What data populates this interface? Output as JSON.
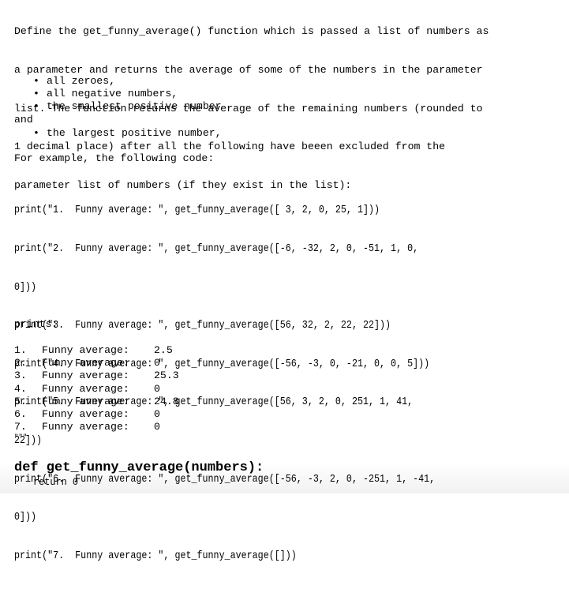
{
  "description": {
    "lines": [
      "Define the get_funny_average() function which is passed a list of numbers as",
      "a parameter and returns the average of some of the numbers in the parameter",
      "list. The function returns the average of the remaining numbers (rounded to",
      "1 decimal place) after all the following have beeen excluded from the",
      "parameter list of numbers (if they exist in the list):"
    ],
    "bullets": [
      "all zeroes,",
      "all negative numbers,",
      "the smallest positive number"
    ],
    "and_word": "and",
    "bullets_after": [
      "the largest positive number,"
    ],
    "bullet_glyph": "•",
    "example_intro": "For example, the following code:"
  },
  "code_example": {
    "lines": [
      "print(\"1.  Funny average: \", get_funny_average([ 3, 2, 0, 25, 1]))",
      "print(\"2.  Funny average: \", get_funny_average([-6, -32, 2, 0, -51, 1, 0,",
      "0]))",
      "print(\"3.  Funny average: \", get_funny_average([56, 32, 2, 22, 22]))",
      "print(\"4.  Funny average: \", get_funny_average([-56, -3, 0, -21, 0, 0, 5]))",
      "print(\"5.  Funny average: \", get_funny_average([56, 3, 2, 0, 251, 1, 41,",
      "22]))",
      "print(\"6.  Funny average: \", get_funny_average([-56, -3, 2, 0, -251, 1, -41,",
      "0]))",
      "print(\"7.  Funny average: \", get_funny_average([]))"
    ]
  },
  "output": {
    "label": "prints:",
    "rows": [
      {
        "num": "1.",
        "label": "Funny average:",
        "value": "2.5"
      },
      {
        "num": "2.",
        "label": "Funny average:",
        "value": "0"
      },
      {
        "num": "3.",
        "label": "Funny average:",
        "value": "25.3"
      },
      {
        "num": "4.",
        "label": "Funny average:",
        "value": "0"
      },
      {
        "num": "5.",
        "label": "Funny average:",
        "value": "24.8"
      },
      {
        "num": "6.",
        "label": "Funny average:",
        "value": "0"
      },
      {
        "num": "7.",
        "label": "Funny average:",
        "value": "0"
      }
    ],
    "closing_quotes": "\"\"\""
  },
  "function_stub": {
    "signature": "def get_funny_average(numbers):",
    "body": "return 0"
  }
}
